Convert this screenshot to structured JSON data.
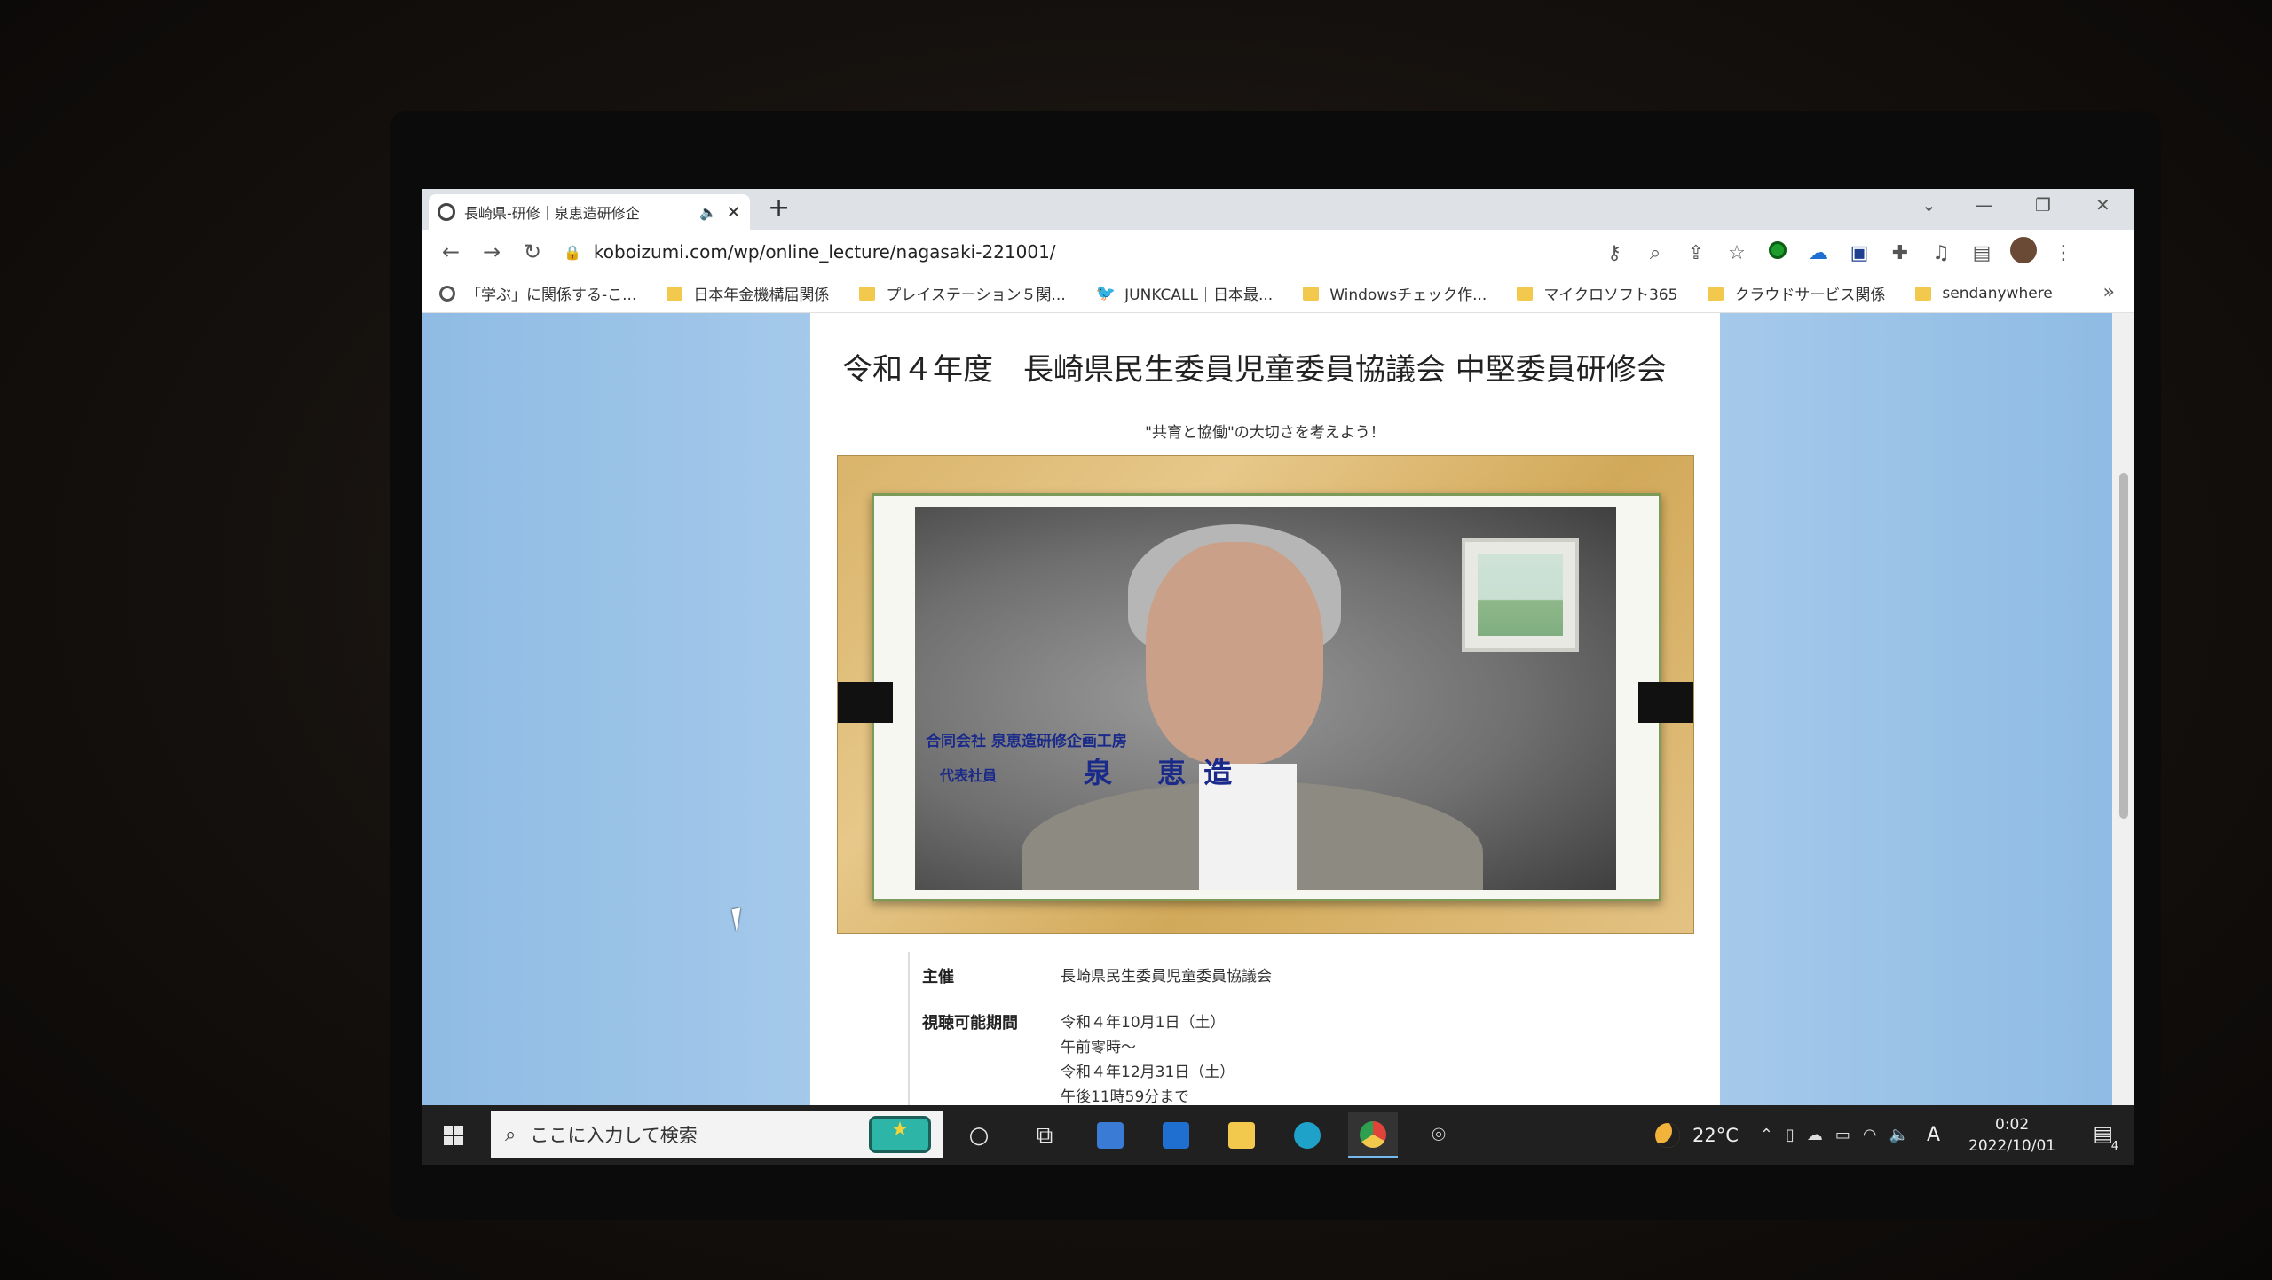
{
  "browser": {
    "tab": {
      "title": "長崎県-研修｜泉恵造研修企",
      "sound_icon": "speaker-icon",
      "close_label": "✕"
    },
    "new_tab_label": "+",
    "window_controls": {
      "tab_search": "⌄",
      "minimize": "—",
      "restore": "❐",
      "close": "✕"
    },
    "nav": {
      "back": "←",
      "forward": "→",
      "reload": "↻"
    },
    "url": "koboizumi.com/wp/online_lecture/nagasaki-221001/",
    "bookmarks": [
      {
        "label": "「学ぶ」に関係する-こ...",
        "icon": "globe-icon"
      },
      {
        "label": "日本年金機構届関係",
        "icon": "folder-icon"
      },
      {
        "label": "プレイステーション５関...",
        "icon": "folder-icon"
      },
      {
        "label": "JUNKCALL｜日本最...",
        "icon": "bird-icon"
      },
      {
        "label": "Windowsチェック作...",
        "icon": "folder-icon"
      },
      {
        "label": "マイクロソフト365",
        "icon": "folder-icon"
      },
      {
        "label": "クラウドサービス関係",
        "icon": "folder-icon"
      },
      {
        "label": "sendanywhere",
        "icon": "folder-icon"
      }
    ],
    "bookmarks_more": "»"
  },
  "page": {
    "title": "令和４年度　長崎県民生委員児童委員協議会 中堅委員研修会",
    "subtitle": "\"共育と協働\"の大切さを考えよう！",
    "video": {
      "caption_company": "合同会社 泉恵造研修企画工房",
      "caption_role": "代表社員",
      "caption_name": "泉 恵造"
    },
    "info": [
      {
        "key": "主催",
        "lines": [
          "長崎県民生委員児童委員協議会"
        ]
      },
      {
        "key": "視聴可能期間",
        "lines": [
          "令和４年10月1日（土）",
          "午前零時～",
          "令和４年12月31日（土）",
          "午後11時59分まで"
        ]
      }
    ]
  },
  "taskbar": {
    "search_placeholder": "ここに入力して検索",
    "apps": [
      {
        "name": "cortana-icon",
        "glyph": "○"
      },
      {
        "name": "task-view-icon",
        "glyph": "⧉"
      },
      {
        "name": "store-icon",
        "color": "#3a7bd5"
      },
      {
        "name": "mail-icon",
        "color": "#1f6fd0"
      },
      {
        "name": "explorer-icon",
        "color": "#f2c94c"
      },
      {
        "name": "edge-icon",
        "color": "#1fa2c9"
      },
      {
        "name": "chrome-icon",
        "color": "#e0433a"
      },
      {
        "name": "camera-icon",
        "glyph": "⌾"
      }
    ],
    "weather_temp": "22°C",
    "ime_label": "A",
    "time": "0:02",
    "date": "2022/10/01",
    "notification_count": "4"
  },
  "colors": {
    "page_background": "#b4d3ef",
    "caption_text": "#1a2a8a",
    "video_frame": "#d9b46a"
  }
}
